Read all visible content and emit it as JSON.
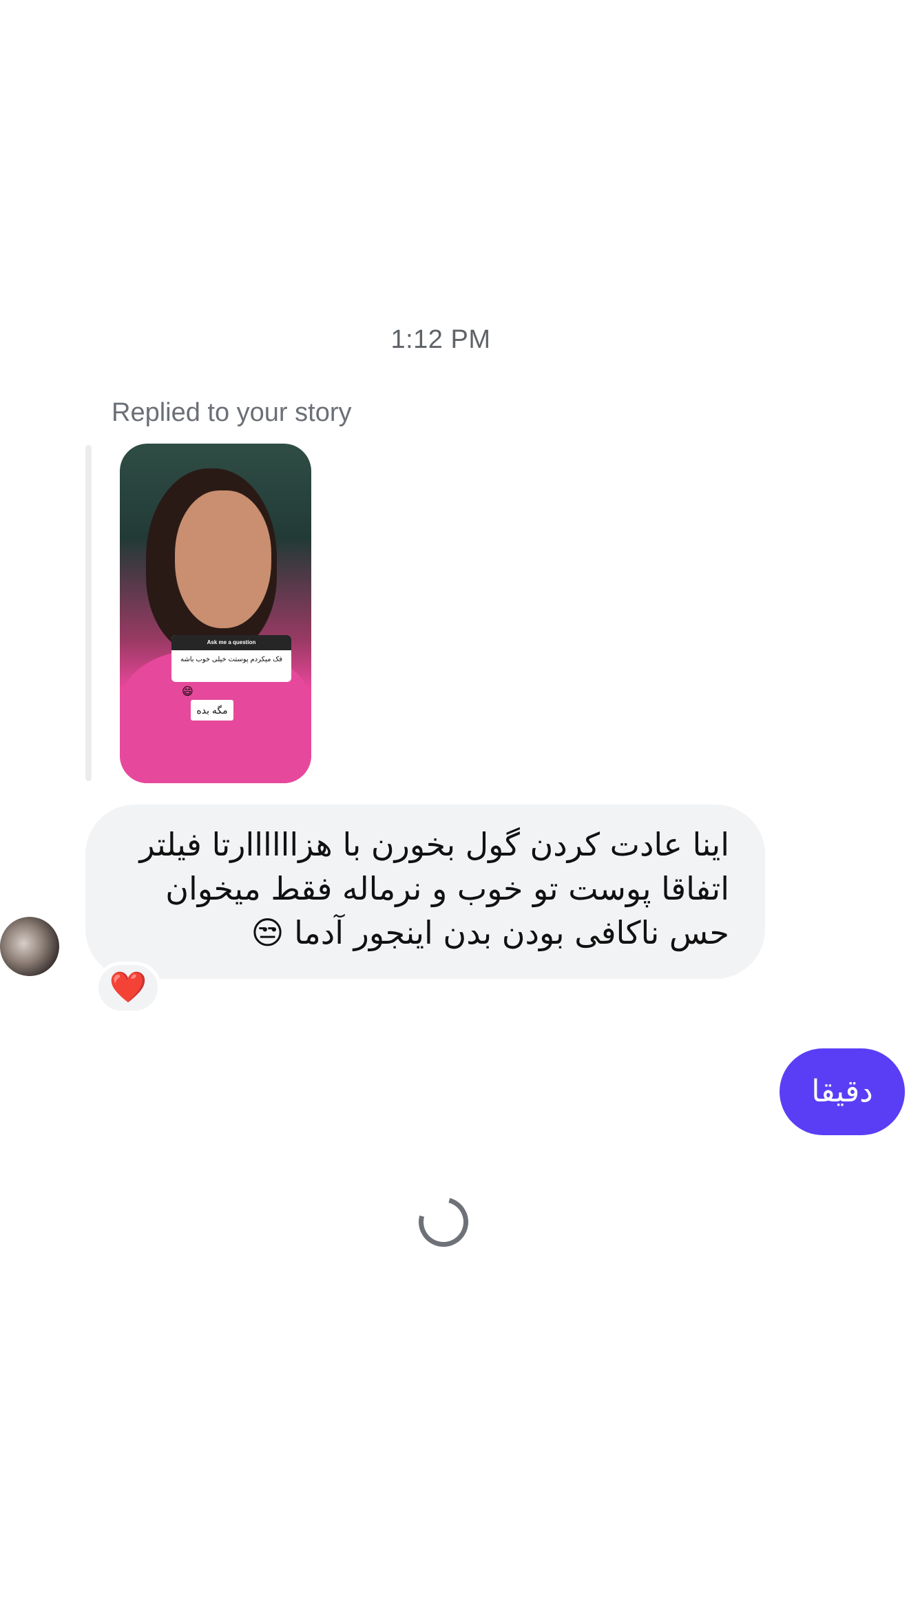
{
  "thread": {
    "timestamp": "1:12 PM",
    "story_reply_label": "Replied to your story"
  },
  "story": {
    "question_header": "Ask me a question",
    "question_text": "فک میکردم پوستت خیلی خوب باشه",
    "answer_text": "مگه بده"
  },
  "incoming_message": {
    "lines": [
      "اینا عادت کردن گول بخورن با هزاااااارتا فیلتر",
      "اتفاقا پوست تو خوب و نرماله فقط میخوان",
      "حس ناکافی بودن بدن اینجور آدما 😒"
    ],
    "reaction": "❤️"
  },
  "outgoing_message": {
    "text": "دقیقا"
  },
  "colors": {
    "outgoing_bubble": "#5a3ef5",
    "incoming_bubble": "#f2f3f5",
    "secondary_text": "#6b6f76"
  }
}
